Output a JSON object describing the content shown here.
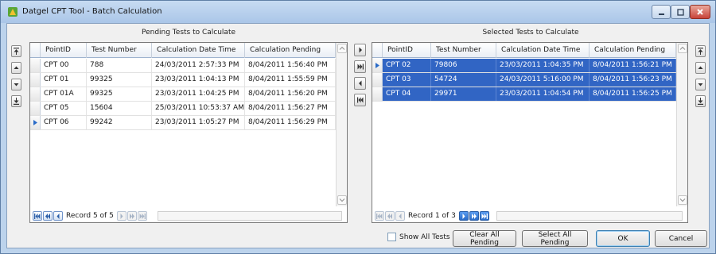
{
  "window": {
    "title": "Datgel CPT Tool - Batch Calculation"
  },
  "pending": {
    "title": "Pending Tests to Calculate",
    "columns": [
      "PointID",
      "Test Number",
      "Calculation Date Time",
      "Calculation Pending"
    ],
    "rows": [
      [
        "CPT 00",
        "788",
        "24/03/2011 2:57:33 PM",
        "8/04/2011 1:56:40 PM"
      ],
      [
        "CPT 01",
        "99325",
        "23/03/2011 1:04:13 PM",
        "8/04/2011 1:55:59 PM"
      ],
      [
        "CPT 01A",
        "99325",
        "23/03/2011 1:04:25 PM",
        "8/04/2011 1:56:20 PM"
      ],
      [
        "CPT 05",
        "15604",
        "25/03/2011 10:53:37 AM",
        "8/04/2011 1:56:27 PM"
      ],
      [
        "CPT 06",
        "99242",
        "23/03/2011 1:05:27 PM",
        "8/04/2011 1:56:29 PM"
      ]
    ],
    "current_row": 4,
    "record_text": "Record 5 of 5"
  },
  "selected": {
    "title": "Selected Tests to Calculate",
    "columns": [
      "PointID",
      "Test Number",
      "Calculation Date Time",
      "Calculation Pending"
    ],
    "rows": [
      [
        "CPT 02",
        "79806",
        "23/03/2011 1:04:35 PM",
        "8/04/2011 1:56:21 PM"
      ],
      [
        "CPT 03",
        "54724",
        "24/03/2011 5:16:00 PM",
        "8/04/2011 1:56:23 PM"
      ],
      [
        "CPT 04",
        "29971",
        "23/03/2011 1:04:54 PM",
        "8/04/2011 1:56:25 PM"
      ]
    ],
    "current_row": 0,
    "record_text": "Record 1 of 3"
  },
  "footer": {
    "show_all_tests_label": "Show All Tests",
    "show_all_tests_checked": false,
    "clear_all_pending_label": "Clear All Pending",
    "select_all_pending_label": "Select All Pending",
    "ok_label": "OK",
    "cancel_label": "Cancel"
  },
  "icons": {
    "move_top": "move-to-top-icon",
    "move_up": "move-up-icon",
    "move_down": "move-down-icon",
    "move_bottom": "move-to-bottom-icon",
    "add_selected": "move-right-icon",
    "add_all": "move-all-right-icon",
    "remove_selected": "move-left-icon",
    "remove_all": "move-all-left-icon"
  },
  "colors": {
    "selection": "#3165c4",
    "title_bar": "#bcd3ec",
    "close_button": "#c8433a"
  }
}
